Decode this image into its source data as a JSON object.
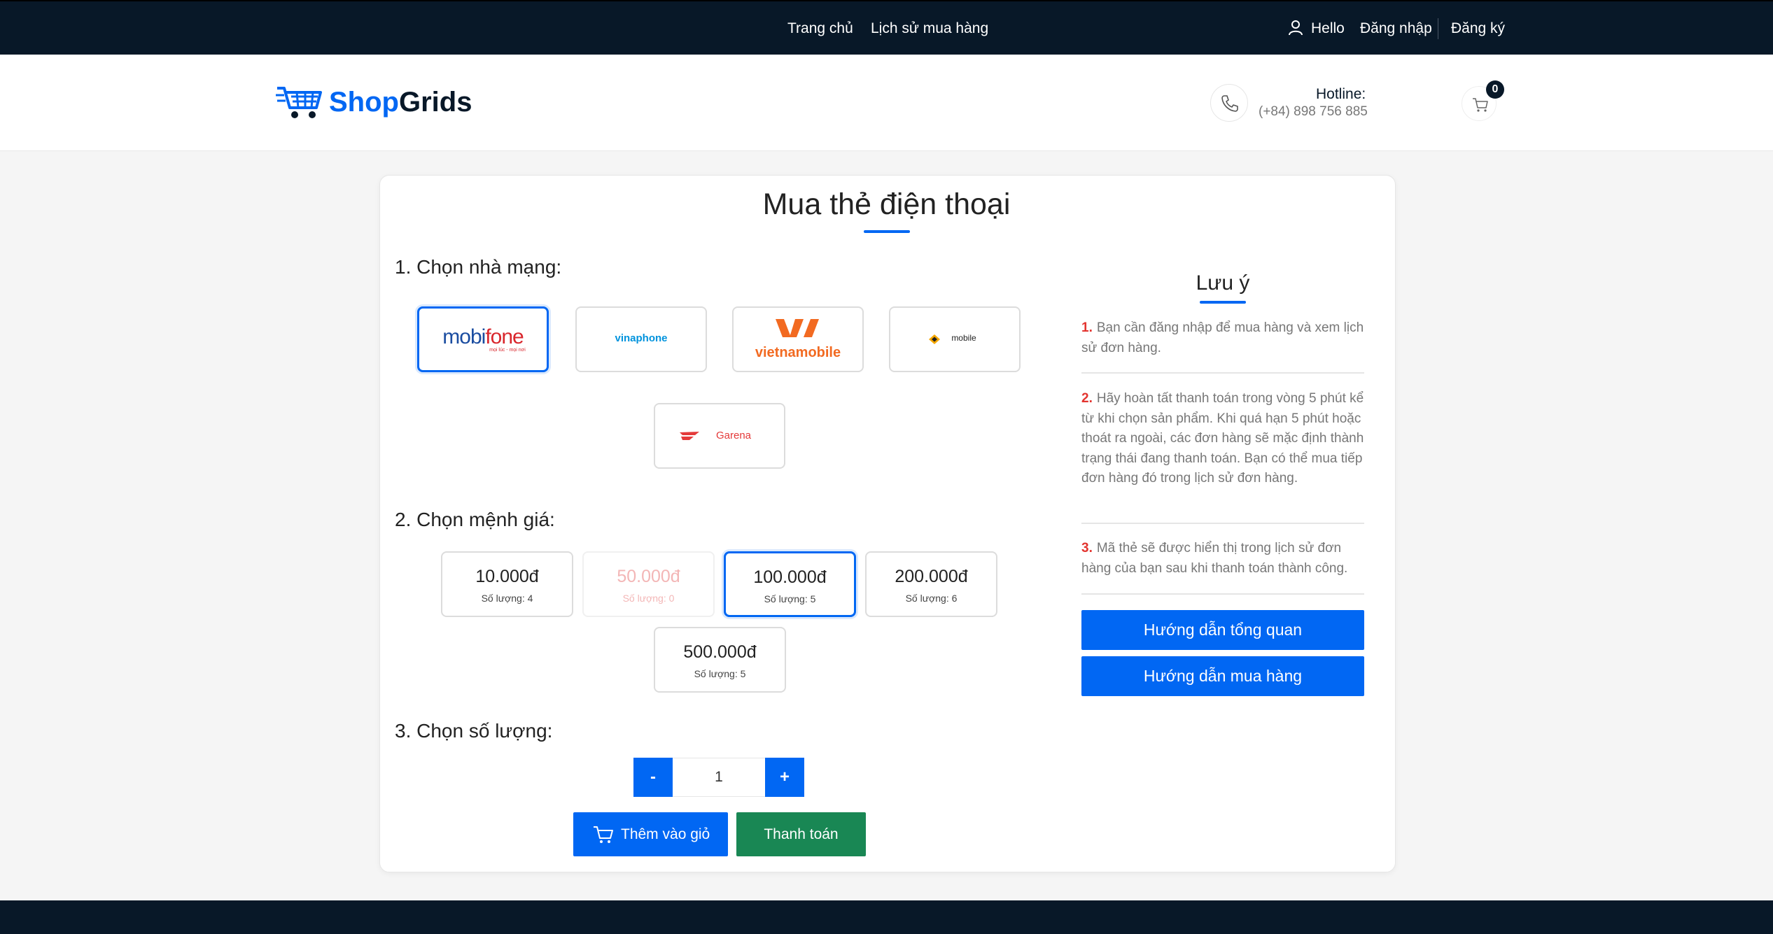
{
  "topbar": {
    "nav": [
      "Trang chủ",
      "Lịch sử mua hàng"
    ],
    "hello": "Hello",
    "login": "Đăng nhập",
    "register": "Đăng ký"
  },
  "header": {
    "logo_shop": "Shop",
    "logo_grids": "Grids",
    "hotline_label": "Hotline:",
    "hotline_number": "(+84) 898 756 885",
    "cart_count": "0"
  },
  "main": {
    "title": "Mua thẻ điện thoại",
    "step1_label": "1. Chọn nhà mạng:",
    "networks": [
      {
        "name": "mobifone",
        "logo_a": "mobi",
        "logo_b": "fone",
        "tagline": "mọi lúc - mọi nơi",
        "selected": true
      },
      {
        "name": "vinaphone",
        "logo": "vinaphone",
        "selected": false
      },
      {
        "name": "vietnamobile",
        "logo": "vietnamobile",
        "selected": false
      },
      {
        "name": "gmobile",
        "logo": "mobile",
        "selected": false
      },
      {
        "name": "garena",
        "logo": "Garena",
        "selected": false
      }
    ],
    "step2_label": "2. Chọn mệnh giá:",
    "prices": [
      {
        "amount": "10.000đ",
        "qty": "Số lượng: 4",
        "state": "normal"
      },
      {
        "amount": "50.000đ",
        "qty": "Số lượng: 0",
        "state": "disabled"
      },
      {
        "amount": "100.000đ",
        "qty": "Số lượng: 5",
        "state": "selected"
      },
      {
        "amount": "200.000đ",
        "qty": "Số lượng: 6",
        "state": "normal"
      },
      {
        "amount": "500.000đ",
        "qty": "Số lượng: 5",
        "state": "normal"
      }
    ],
    "step3_label": "3. Chọn số lượng:",
    "stepper": {
      "minus": "-",
      "value": "1",
      "plus": "+"
    },
    "add_to_cart": "Thêm vào giỏ",
    "checkout": "Thanh toán"
  },
  "notes": {
    "title": "Lưu ý",
    "items": [
      {
        "num": "1.",
        "text": "Bạn cần đăng nhập để mua hàng và xem lịch sử đơn hàng."
      },
      {
        "num": "2.",
        "text": "Hãy hoàn tất thanh toán trong vòng 5 phút kể từ khi chọn sản phẩm. Khi quá hạn 5 phút hoặc thoát ra ngoài, các đơn hàng sẽ mặc định thành trạng thái đang thanh toán. Bạn có thể mua tiếp đơn hàng đó trong lịch sử đơn hàng."
      },
      {
        "num": "3.",
        "text": "Mã thẻ sẽ được hiển thị trong lịch sử đơn hàng của bạn sau khi thanh toán thành công."
      }
    ],
    "guide_overview": "Hướng dẫn tổng quan",
    "guide_buy": "Hướng dẫn mua hàng"
  },
  "colors": {
    "dark": "#081828",
    "primary": "#0167f3",
    "success": "#198754",
    "danger": "#e3342f"
  }
}
